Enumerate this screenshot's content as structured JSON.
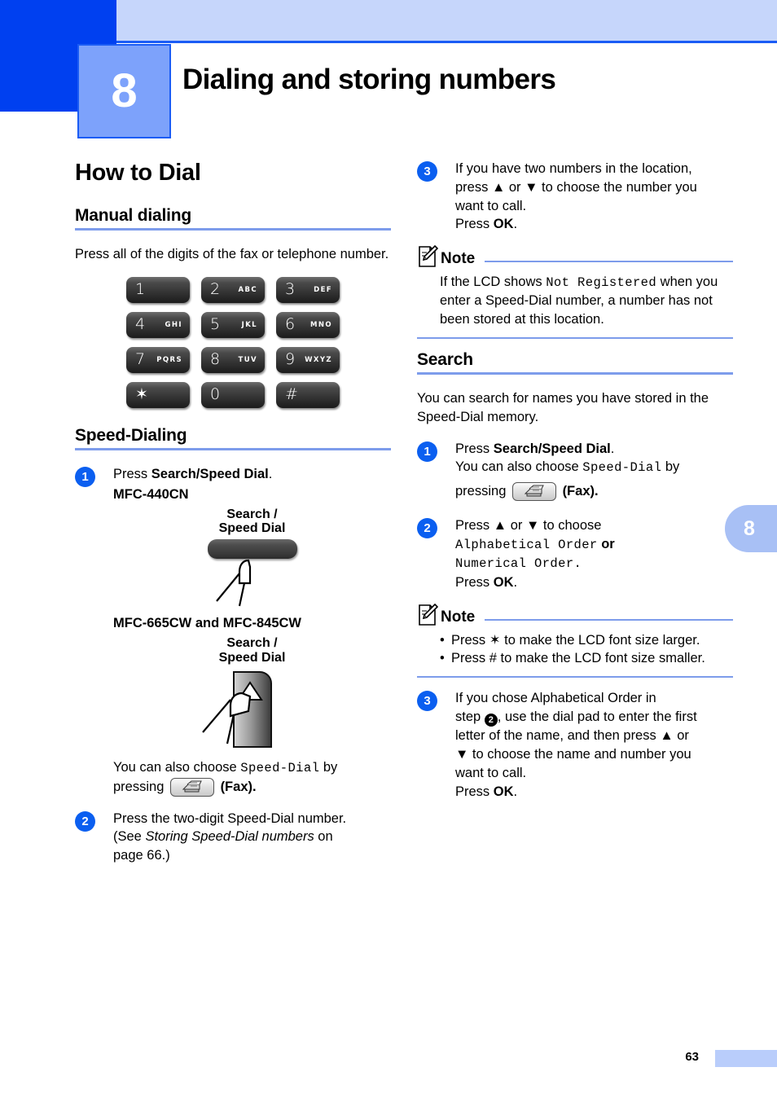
{
  "header": {
    "chapter_number": "8",
    "chapter_title": "Dialing and storing numbers"
  },
  "colors": {
    "dark_blue": "#0040f0",
    "light_blue_bar": "#c6d6fb",
    "chapter_box": "#7da2fb",
    "rule_blue": "#7d9ceb",
    "step_circle": "#0b5ff0",
    "side_tab": "#a8c0f5"
  },
  "left_column": {
    "section_title": "How to Dial",
    "manual": {
      "heading": "Manual dialing",
      "body": "Press all of the digits of the fax or telephone number."
    },
    "keypad": {
      "keys": [
        {
          "digit": "1",
          "letters": ""
        },
        {
          "digit": "2",
          "letters": "ABC"
        },
        {
          "digit": "3",
          "letters": "DEF"
        },
        {
          "digit": "4",
          "letters": "GHI"
        },
        {
          "digit": "5",
          "letters": "JKL"
        },
        {
          "digit": "6",
          "letters": "MNO"
        },
        {
          "digit": "7",
          "letters": "PQRS"
        },
        {
          "digit": "8",
          "letters": "TUV"
        },
        {
          "digit": "9",
          "letters": "WXYZ"
        },
        {
          "digit": "✶",
          "letters": ""
        },
        {
          "digit": "0",
          "letters": ""
        },
        {
          "digit": "#",
          "letters": ""
        }
      ]
    },
    "speed_dialing": {
      "heading": "Speed-Dialing",
      "step1": {
        "number": "1",
        "text_prefix": "Press ",
        "text_bold": "Search/Speed Dial",
        "text_suffix": "."
      },
      "model_1": "MFC-440CN",
      "button_caption_line1": "Search /",
      "button_caption_line2": "Speed Dial",
      "model_2": "MFC-665CW and MFC-845CW",
      "also_choose_prefix": "You can also choose ",
      "also_choose_mono": "Speed-Dial",
      "also_choose_suffix": " by",
      "pressing_label": "pressing",
      "fax_label": "(Fax).",
      "step2": {
        "number": "2",
        "line1": "Press the two-digit Speed-Dial number.",
        "line2_prefix": "(See ",
        "line2_italic": "Storing Speed-Dial numbers",
        "line2_suffix": " on",
        "line3": "page 66.)"
      }
    }
  },
  "right_column": {
    "step3_top": {
      "number": "3",
      "line1": "If you have two numbers in the location,",
      "line2a": "press ",
      "line2_up": "▲",
      "line2b": " or ",
      "line2_down": "▼",
      "line2c": " to choose the number you",
      "line3": "want to call.",
      "line4_prefix": "Press ",
      "line4_bold": "OK",
      "line4_suffix": "."
    },
    "note1": {
      "label": "Note",
      "prefix": "If the LCD shows ",
      "mono": "Not Registered",
      "suffix": " when you enter a Speed-Dial number, a number has not been stored at this location."
    },
    "search": {
      "heading": "Search",
      "intro": "You can search for names you have stored in the Speed-Dial memory.",
      "step1": {
        "number": "1",
        "line1_prefix": "Press ",
        "line1_bold": "Search/Speed Dial",
        "line1_suffix": ".",
        "line2_prefix": "You can also choose ",
        "line2_mono": "Speed-Dial",
        "line2_suffix": " by",
        "line3_prefix": "pressing",
        "line3_suffix": "(Fax)."
      },
      "step2": {
        "number": "2",
        "line1a": "Press ",
        "line1_up": "▲",
        "line1b": " or ",
        "line1_down": "▼",
        "line1c": " to choose",
        "line2_mono": "Alphabetical Order",
        "line2_suffix": " or",
        "line3_mono": "Numerical Order.",
        "line4_prefix": "Press ",
        "line4_bold": "OK",
        "line4_suffix": "."
      },
      "note2": {
        "label": "Note",
        "bullets": [
          "Press ✶ to make the LCD font size larger.",
          "Press # to make the LCD font size smaller."
        ]
      },
      "step3": {
        "number": "3",
        "line1": "If you chose Alphabetical Order in",
        "line2_prefix": "step ",
        "line2_inline_num": "2",
        "line2_suffix": ", use the dial pad to enter the first",
        "line3a": "letter of the name, and then press ",
        "line3_up": "▲",
        "line3b": " or",
        "line4_down": "▼",
        "line4": " to choose the name and number you",
        "line5": "want to call.",
        "line6_prefix": "Press ",
        "line6_bold": "OK",
        "line6_suffix": "."
      }
    }
  },
  "side_tab": {
    "label": "8"
  },
  "footer": {
    "page_number": "63"
  }
}
